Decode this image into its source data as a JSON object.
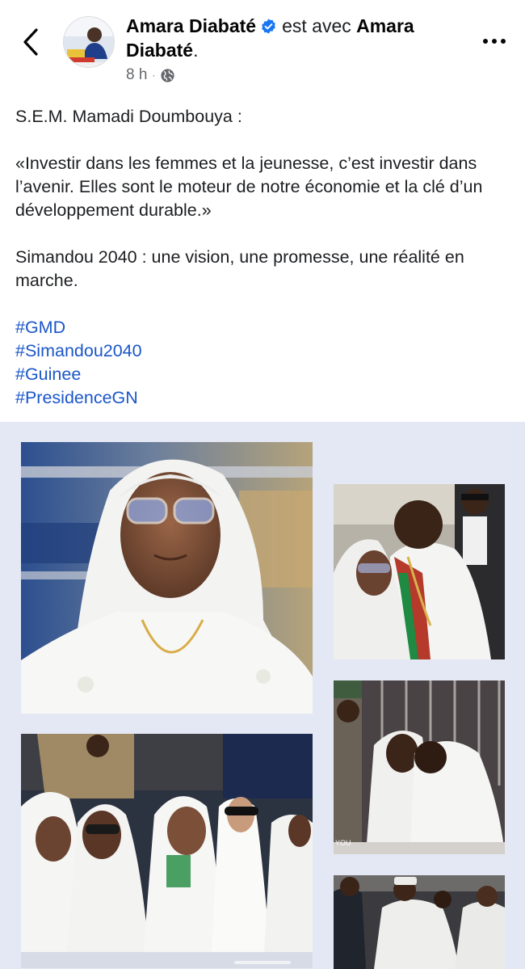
{
  "header": {
    "author_name": "Amara Diabaté",
    "with_text": "est avec",
    "tagged_name": "Amara Diabaté",
    "tagged_suffix": ".",
    "time": "8 h",
    "icons": {
      "back": "chevron-left-icon",
      "verified": "verified-badge-icon",
      "audience": "globe-icon",
      "more": "more-options-icon"
    },
    "verified_color": "#1877f2"
  },
  "post": {
    "line1": "S.E.M. Mamadi Doumbouya  :",
    "quote": "«Investir dans les femmes et la jeunesse, c’est investir dans l’avenir. Elles sont le moteur de notre économie et la clé d’un développement durable.»",
    "statement": "Simandou 2040 : une vision, une promesse, une réalité en marche.",
    "hashtags": [
      "#GMD",
      "#Simandou2040",
      "#Guinee",
      "#PresidenceGN"
    ],
    "hashtag_color": "#1a56c9"
  },
  "gallery": {
    "background": "#e4e8f4",
    "photo_watermark": "YOU",
    "photos": [
      {
        "name": "photo-woman-white-veil"
      },
      {
        "name": "photo-president-embrace"
      },
      {
        "name": "photo-women-seated-row"
      },
      {
        "name": "photo-president-hug"
      },
      {
        "name": "photo-crowd-bottom"
      }
    ]
  }
}
